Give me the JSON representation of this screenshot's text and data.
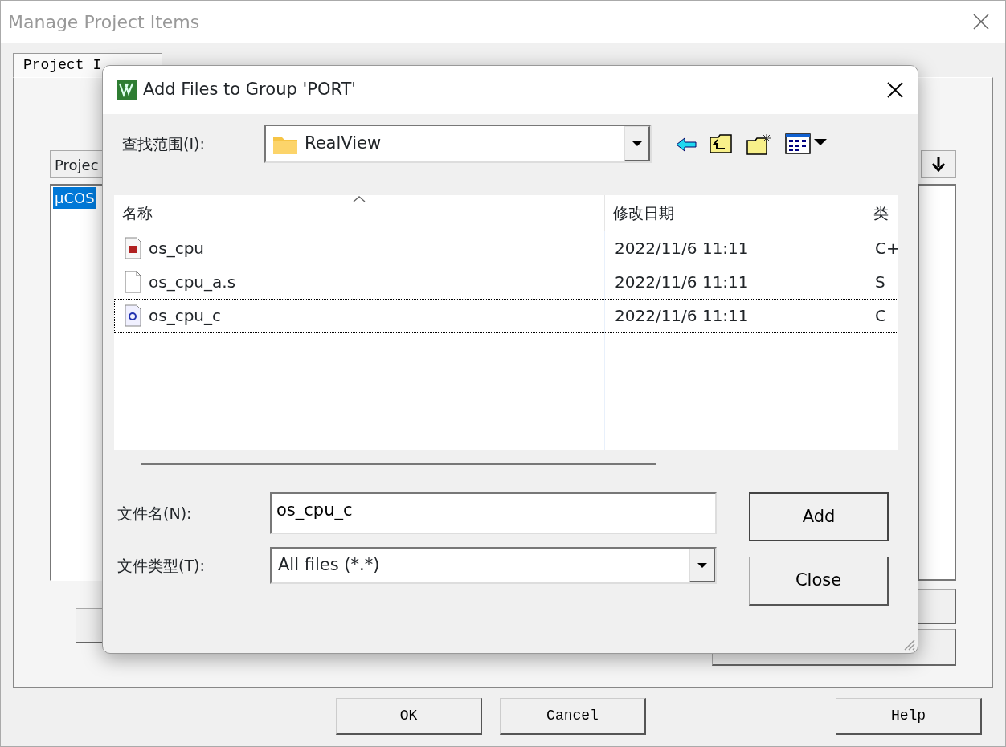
{
  "window": {
    "title": "Manage Project Items",
    "active": false
  },
  "tabs": [
    {
      "label": "Project I",
      "selected": true
    }
  ],
  "groups_panel": {
    "header": "Projec",
    "items": [
      {
        "label": "μCOS",
        "selected": true
      }
    ]
  },
  "footer_buttons": [
    "OK",
    "Cancel",
    "Help"
  ],
  "dialog": {
    "title": "Add Files to Group 'PORT'",
    "look_in": {
      "label": "查找范围(I):",
      "value": "RealView"
    },
    "columns": [
      {
        "label": "名称",
        "sorted": true
      },
      {
        "label": "修改日期",
        "sorted": false
      },
      {
        "label": "类",
        "sorted": false
      }
    ],
    "files": [
      {
        "name": "os_cpu",
        "kind": "header",
        "date": "2022/11/6 11:11",
        "type": "C+",
        "focused": false
      },
      {
        "name": "os_cpu_a.s",
        "kind": "plain",
        "date": "2022/11/6 11:11",
        "type": "S",
        "focused": false
      },
      {
        "name": "os_cpu_c",
        "kind": "source",
        "date": "2022/11/6 11:11",
        "type": "C",
        "focused": true
      }
    ],
    "file_name": {
      "label": "文件名(N):",
      "value": "os_cpu_c"
    },
    "file_type": {
      "label": "文件类型(T):",
      "value": "All files (*.*)"
    },
    "buttons": [
      "Add",
      "Close"
    ]
  }
}
